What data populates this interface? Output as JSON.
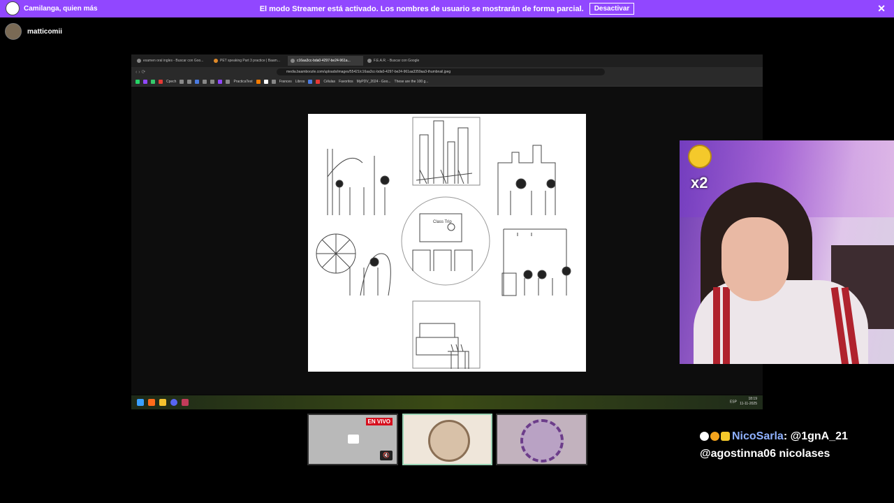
{
  "banner": {
    "message": "El modo Streamer está activado. Los nombres de usuario se mostrarán de forma parcial.",
    "deactivate_label": "Desactivar",
    "close_symbol": "✕",
    "channel_name": "Camilanga, quien más"
  },
  "user2": {
    "name": "matticomii"
  },
  "browser": {
    "tabs": [
      {
        "label": "examen oral ingles - Buscar con Goo..."
      },
      {
        "label": "PET speaking Part 3 practice | Baam..."
      },
      {
        "label": "c16aa3cc-bda0-4297-be24-961a..."
      },
      {
        "label": "F.E.A.R. - Buscar con Google"
      }
    ],
    "url": "media.baamboozle.com/uploads/images/55421/c16aa3cc-bda0-4297-be24-961aa3359aa3-thumbnail.jpeg",
    "bookmarks": [
      "Cpech",
      "PracticaTest",
      "Frances",
      "Libros",
      "Células",
      "Favoritos",
      "MyPDV_2024 - Goo...",
      "These are the 100 g..."
    ],
    "image_caption": "Class Trip"
  },
  "taskbar": {
    "lang": "ESP",
    "time": "18:19",
    "date": "11-11-2025"
  },
  "webcam": {
    "multiplier": "x2"
  },
  "scenes": {
    "live_badge": "EN VIVO"
  },
  "chat": {
    "user": "NicoSarla",
    "message_part1": ": @1gnA_21",
    "message_part2": "@agostinna06 nicolases"
  },
  "colors": {
    "banner": "#9147ff",
    "chat_nick": "#8fb1ff",
    "live_badge": "#d60f1e",
    "taskbar_accent": "#3a4a15"
  }
}
